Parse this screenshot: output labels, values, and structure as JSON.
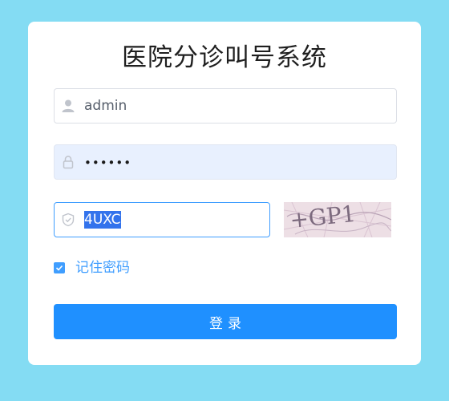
{
  "form": {
    "title": "医院分诊叫号系统",
    "username": {
      "value": "admin",
      "icon": "user-icon"
    },
    "password": {
      "masked_value": "••••••",
      "icon": "lock-icon"
    },
    "captcha": {
      "value": "4UXC",
      "icon": "shield-icon",
      "image_text": "+GP1"
    },
    "remember": {
      "label": "记住密码",
      "checked": true
    },
    "login_label": "登录"
  },
  "colors": {
    "background": "#84dcf3",
    "primary": "#1f90ff",
    "checkbox": "#409eff",
    "autofill": "#e8f0fe"
  }
}
